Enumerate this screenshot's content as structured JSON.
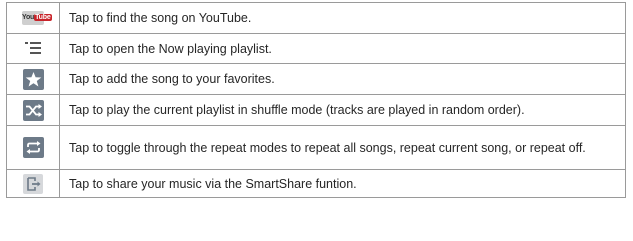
{
  "rows": [
    {
      "icon": "youtube-icon",
      "icon_text_left": "You",
      "icon_text_right": "Tube",
      "text": "Tap to find the song on YouTube."
    },
    {
      "icon": "playlist-icon",
      "text": "Tap to open the Now playing playlist."
    },
    {
      "icon": "star-icon",
      "text": "Tap to add the song to your favorites."
    },
    {
      "icon": "shuffle-icon",
      "text": "Tap to play the current playlist in shuffle mode (tracks are played in random order)."
    },
    {
      "icon": "repeat-icon",
      "text": "Tap to toggle through the repeat modes to repeat all songs, repeat current song, or repeat off."
    },
    {
      "icon": "smartshare-icon",
      "text": "Tap to share your music via the SmartShare funtion."
    }
  ],
  "colors": {
    "border": "#9a9a9a",
    "icon_dark": "#6d7a88",
    "icon_light": "#d6d8db",
    "youtube_red": "#c8242a"
  }
}
